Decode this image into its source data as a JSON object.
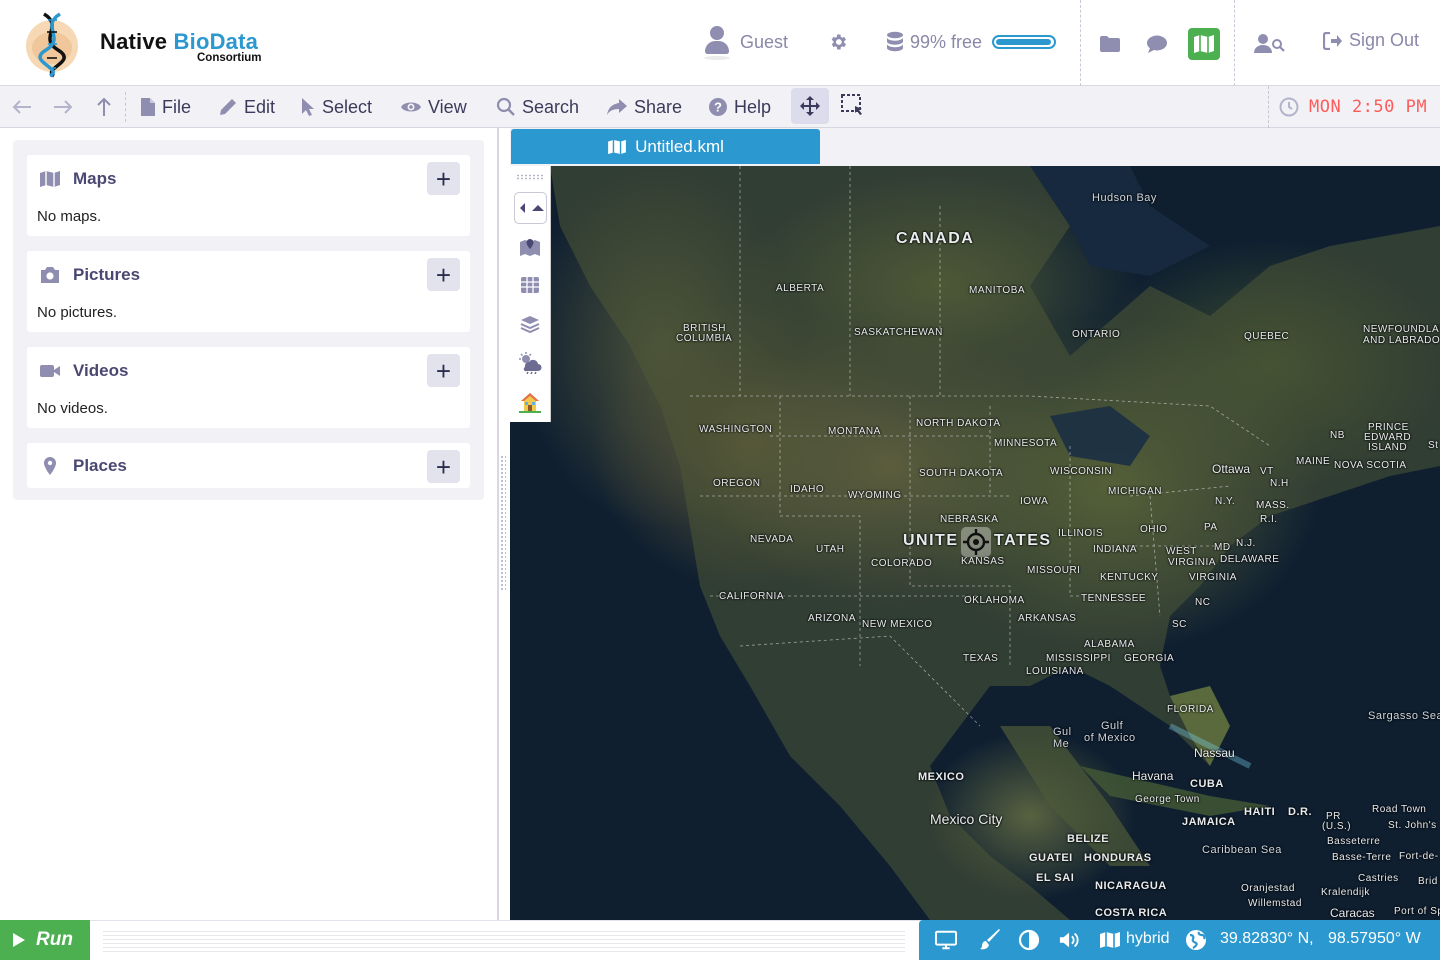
{
  "header": {
    "brand_name_part1": "Native ",
    "brand_name_part2": "BioData",
    "brand_sub": "Consortium",
    "user_label": "Guest",
    "storage_label": "99% free",
    "storage_percent_free": 99,
    "signout_label": "Sign Out",
    "accent_color": "#2b98cf",
    "active_color": "#4caf50"
  },
  "toolbar": {
    "menus": [
      {
        "label": "File",
        "icon": "file-icon"
      },
      {
        "label": "Edit",
        "icon": "pencil-icon"
      },
      {
        "label": "Select",
        "icon": "cursor-icon"
      },
      {
        "label": "View",
        "icon": "eye-icon"
      },
      {
        "label": "Search",
        "icon": "search-icon"
      },
      {
        "label": "Share",
        "icon": "share-icon"
      },
      {
        "label": "Help",
        "icon": "help-icon"
      }
    ],
    "clock": "MON 2:50 PM"
  },
  "sidebar": {
    "cards": [
      {
        "title": "Maps",
        "empty_text": "No maps.",
        "icon": "map-icon"
      },
      {
        "title": "Pictures",
        "empty_text": "No pictures.",
        "icon": "camera-icon"
      },
      {
        "title": "Videos",
        "empty_text": "No videos.",
        "icon": "video-icon"
      },
      {
        "title": "Places",
        "empty_text": "",
        "icon": "map-pin-icon"
      }
    ],
    "add_label": "+"
  },
  "map": {
    "tab_label": "Untitled.kml",
    "labels": {
      "hudson_bay": "Hudson Bay",
      "canada": "CANADA",
      "alberta": "ALBERTA",
      "manitoba": "MANITOBA",
      "british_columbia_1": "BRITISH",
      "british_columbia_2": "COLUMBIA",
      "saskatchewan": "SASKATCHEWAN",
      "ontario": "ONTARIO",
      "quebec": "QUEBEC",
      "newfoundland_1": "NEWFOUNDLAN",
      "newfoundland_2": "AND LABRADO",
      "washington": "WASHINGTON",
      "montana": "MONTANA",
      "north_dakota": "NORTH DAKOTA",
      "minnesota": "MINNESOTA",
      "prince_edward_1": "PRINCE",
      "prince_edward_2": "EDWARD",
      "prince_edward_3": "ISLAND",
      "nb": "NB",
      "nova_scotia": "NOVA SCOTIA",
      "st": "St",
      "ottawa": "Ottawa",
      "vt": "VT",
      "maine": "MAINE",
      "nh": "N.H",
      "oregon": "OREGON",
      "idaho": "IDAHO",
      "south_dakota": "SOUTH DAKOTA",
      "wisconsin": "WISCONSIN",
      "michigan": "MICHIGAN",
      "ny": "N.Y.",
      "mass": "MASS.",
      "ri": "R.I.",
      "wyoming": "WYOMING",
      "iowa": "IOWA",
      "nebraska": "NEBRASKA",
      "illinois": "ILLINOIS",
      "ohio": "OHIO",
      "pa": "PA",
      "nj": "N.J.",
      "md": "MD",
      "delaware": "DELAWARE",
      "nevada": "NEVADA",
      "utah": "UTAH",
      "united_states_1": "UNITE",
      "united_states_2": "TATES",
      "indiana": "INDIANA",
      "west_virginia_1": "WEST",
      "west_virginia_2": "VIRGINIA",
      "colorado": "COLORADO",
      "kansas": "KANSAS",
      "missouri": "MISSOURI",
      "kentucky": "KENTUCKY",
      "virginia": "VIRGINIA",
      "california": "CALIFORNIA",
      "oklahoma": "OKLAHOMA",
      "tennessee": "TENNESSEE",
      "nc": "NC",
      "arizona": "ARIZONA",
      "new_mexico": "NEW MEXICO",
      "arkansas": "ARKANSAS",
      "sc": "SC",
      "alabama": "ALABAMA",
      "texas": "TEXAS",
      "mississippi": "MISSISSIPPI",
      "georgia": "GEORGIA",
      "louisiana": "LOUISIANA",
      "florida": "FLORIDA",
      "sargasso": "Sargasso Sea",
      "gulf1": "Gul",
      "gulf2": "Me",
      "gulf_of_mexico_1": "Gulf",
      "gulf_of_mexico_2": "of Mexico",
      "nassau": "Nassau",
      "mexico": "MEXICO",
      "havana": "Havana",
      "cuba": "CUBA",
      "george_town": "George Town",
      "haiti": "HAITI",
      "dr": "D.R.",
      "pr_1": "PR",
      "pr_2": "(U.S.)",
      "road_town": "Road Town",
      "st_johns": "St. John's",
      "mexico_city": "Mexico City",
      "jamaica": "JAMAICA",
      "basseterre": "Basseterre",
      "basse_terre": "Basse-Terre",
      "fort_de": "Fort-de-",
      "belize": "BELIZE",
      "guatemala": "GUATEI",
      "honduras": "HONDURAS",
      "caribbean": "Caribbean Sea",
      "castries": "Castries",
      "bridgetown": "Brid",
      "el_salvador": "EL SAI",
      "nicaragua": "NICARAGUA",
      "oranjestad": "Oranjestad",
      "kralendijk": "Kralendijk",
      "willemstad": "Willemstad",
      "costa_rica": "COSTA RICA",
      "caracas": "Caracas",
      "port_of_spain": "Port of Sp"
    }
  },
  "statusbar": {
    "run_label": "Run",
    "map_style": "hybrid",
    "latitude": "39.82830° N,",
    "longitude": "98.57950° W"
  }
}
